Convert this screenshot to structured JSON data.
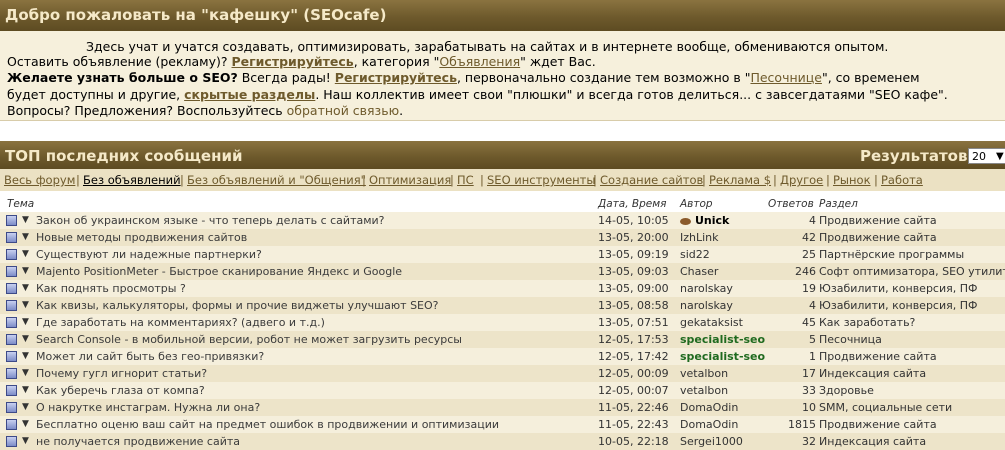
{
  "header": {
    "title": "Добро пожаловать на \"кафешку\" (SEOcafe)"
  },
  "welcome": {
    "line1": "Здесь учат и учатся создавать, оптимизировать, зарабатывать на сайтах и в интернете вообще, обмениваются опытом.",
    "line2_a": "Оставить объявление (рекламу)? ",
    "line2_link": "Регистрируйтесь",
    "line2_b": ", категория \"",
    "line2_link2": "Объявления",
    "line2_c": "\" ждет Вас.",
    "line3_bold": "Желаете узнать больше о SEO?",
    "line3_a": " Всегда рады! ",
    "line3_link": "Регистрируйтесь",
    "line3_b": ", первоначально создание тем возможно в \"",
    "line3_link2": "Песочнице",
    "line3_c": "\", со временем",
    "line4_a": "будет доступны и другие, ",
    "line4_link": "скрытые разделы",
    "line4_b": ". Наш коллектив имеет свои \"плюшки\" и всегда готов делиться... с завсегдатаями \"SEO кафе\".",
    "line5_a": "Вопросы? Предложения? Воспользуйтесь ",
    "line5_link": "обратной связью",
    "line5_b": "."
  },
  "top": {
    "title": "ТОП последних сообщений",
    "results_label": "Результатов",
    "results_value": "20"
  },
  "filters": [
    "Весь форум",
    "Без объявлений",
    "Без объявлений и \"Общения\"",
    "Оптимизация",
    "ПС",
    "SEO инструменты",
    "Создание сайтов",
    "Реклама $",
    "Другое",
    "Рынок",
    "Работа"
  ],
  "columns": {
    "topic": "Тема",
    "date": "Дата, Время",
    "author": "Автор",
    "answers": "Ответов",
    "section": "Раздел"
  },
  "rows": [
    {
      "topic": "Закон об украинском языке - что теперь делать с сайтами?",
      "date": "14-05, 10:05",
      "author": "Unick",
      "answers": "4",
      "section": "Продвижение сайта"
    },
    {
      "topic": "Новые методы продвижения сайтов",
      "date": "13-05, 20:00",
      "author": "IzhLink",
      "answers": "42",
      "section": "Продвижение сайта"
    },
    {
      "topic": "Существуют ли надежные партнерки?",
      "date": "13-05, 09:19",
      "author": "sid22",
      "answers": "25",
      "section": "Партнёрские программы"
    },
    {
      "topic": "Majento PositionMeter - Быстрое сканирование Яндекс и Google",
      "date": "13-05, 09:03",
      "author": "Chaser",
      "answers": "246",
      "section": "Софт оптимизатора, SEO утилиты"
    },
    {
      "topic": "Как поднять просмотры ?",
      "date": "13-05, 09:00",
      "author": "narolskay",
      "answers": "19",
      "section": "Юзабилити, конверсия, ПФ"
    },
    {
      "topic": "Как квизы, калькуляторы, формы и прочие виджеты улучшают SEO?",
      "date": "13-05, 08:58",
      "author": "narolskay",
      "answers": "4",
      "section": "Юзабилити, конверсия, ПФ"
    },
    {
      "topic": "Где заработать на комментариях? (адвего и т.д.)",
      "date": "13-05, 07:51",
      "author": "gekataksist",
      "answers": "45",
      "section": "Как заработать?"
    },
    {
      "topic": "Search Console - в мобильной версии, робот не может загрузить ресурсы",
      "date": "12-05, 17:53",
      "author": "specialist-seo",
      "answers": "5",
      "section": "Песочница"
    },
    {
      "topic": "Может ли сайт быть без гео-привязки?",
      "date": "12-05, 17:42",
      "author": "specialist-seo",
      "answers": "1",
      "section": "Продвижение сайта"
    },
    {
      "topic": "Почему гугл игнорит статьи?",
      "date": "12-05, 00:09",
      "author": "vetalbon",
      "answers": "17",
      "section": "Индексация сайта"
    },
    {
      "topic": "Как уберечь глаза от компа?",
      "date": "12-05, 00:07",
      "author": "vetalbon",
      "answers": "33",
      "section": "Здоровье"
    },
    {
      "topic": "О накрутке инстаграм. Нужна ли она?",
      "date": "11-05, 22:46",
      "author": "DomaOdin",
      "answers": "10",
      "section": "SMM, социальные сети"
    },
    {
      "topic": "Бесплатно оценю ваш сайт на предмет ошибок в продвижении и оптимизации",
      "date": "11-05, 22:43",
      "author": "DomaOdin",
      "answers": "1815",
      "section": "Продвижение сайта"
    },
    {
      "topic": "не получается продвижение сайта",
      "date": "10-05, 22:18",
      "author": "Sergei1000",
      "answers": "32",
      "section": "Индексация сайта"
    }
  ]
}
